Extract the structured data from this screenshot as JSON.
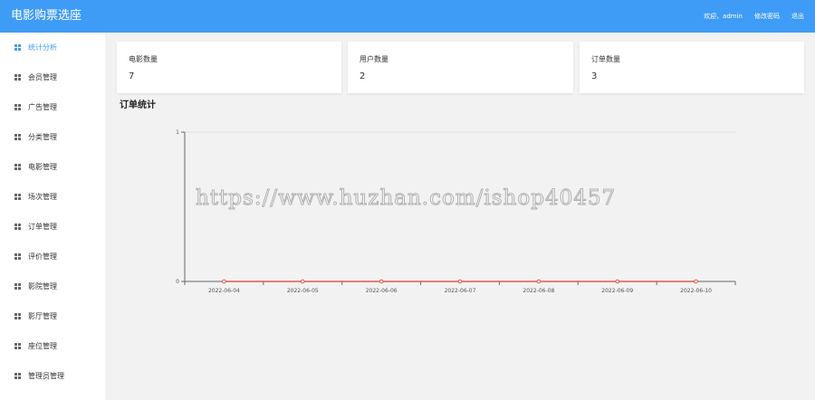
{
  "header": {
    "title": "电影购票选座",
    "welcome": "欢迎，admin",
    "change_password": "修改密码",
    "logout": "退出"
  },
  "sidebar": {
    "items": [
      {
        "label": "统计分析",
        "active": true
      },
      {
        "label": "会员管理"
      },
      {
        "label": "广告管理"
      },
      {
        "label": "分类管理"
      },
      {
        "label": "电影管理"
      },
      {
        "label": "场次管理"
      },
      {
        "label": "订单管理"
      },
      {
        "label": "评价管理"
      },
      {
        "label": "影院管理"
      },
      {
        "label": "影厅管理"
      },
      {
        "label": "座位管理"
      },
      {
        "label": "管理员管理"
      }
    ]
  },
  "cards": [
    {
      "title": "电影数量",
      "value": "7"
    },
    {
      "title": "用户数量",
      "value": "2"
    },
    {
      "title": "订单数量",
      "value": "3"
    }
  ],
  "section_title": "订单统计",
  "watermark": "https://www.huzhan.com/ishop40457",
  "colors": {
    "accent": "#3f9cf6",
    "series": "#e05a4f"
  },
  "chart_data": {
    "type": "line",
    "categories": [
      "2022-06-04",
      "2022-06-05",
      "2022-06-06",
      "2022-06-07",
      "2022-06-08",
      "2022-06-09",
      "2022-06-10"
    ],
    "series": [
      {
        "values": [
          0,
          0,
          0,
          0,
          0,
          0,
          0
        ]
      }
    ],
    "ylim": [
      0,
      1
    ],
    "yticks": [
      "0",
      "1"
    ],
    "grid": true
  }
}
